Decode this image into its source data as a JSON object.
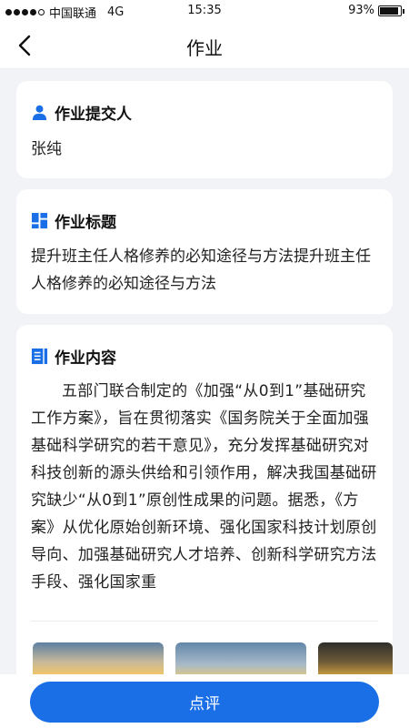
{
  "status_bar": {
    "carrier": "中国联通",
    "network": "4G",
    "time": "15:35",
    "battery": "93%",
    "battery_level": 0.93
  },
  "nav": {
    "title": "作业",
    "back_icon": "chevron-left-icon"
  },
  "submitter": {
    "label": "作业提交人",
    "icon": "person-icon",
    "value": "张纯"
  },
  "homework_title": {
    "label": "作业标题",
    "icon": "grid-icon",
    "value": "提升班主任人格修养的必知途径与方法提升班主任人格修养的必知途径与方法"
  },
  "homework_content": {
    "label": "作业内容",
    "icon": "document-icon",
    "value": "五部门联合制定的《加强“从0到1”基础研究工作方案》，旨在贯彻落实《国务院关于全面加强基础科学研究的若干意见》，充分发挥基础研究对科技创新的源头供给和引领作用，解决我国基础研究缺少“从0到1”原创性成果的问题。据悉，《方案》从优化原始创新环境、强化国家科技计划原创导向、加强基础研究人才培养、创新科学研究方法手段、强化国家重"
  },
  "review_button": {
    "label": "点评"
  },
  "colors": {
    "accent": "#1a6fe6",
    "background": "#f2f3f7",
    "card": "#ffffff"
  }
}
